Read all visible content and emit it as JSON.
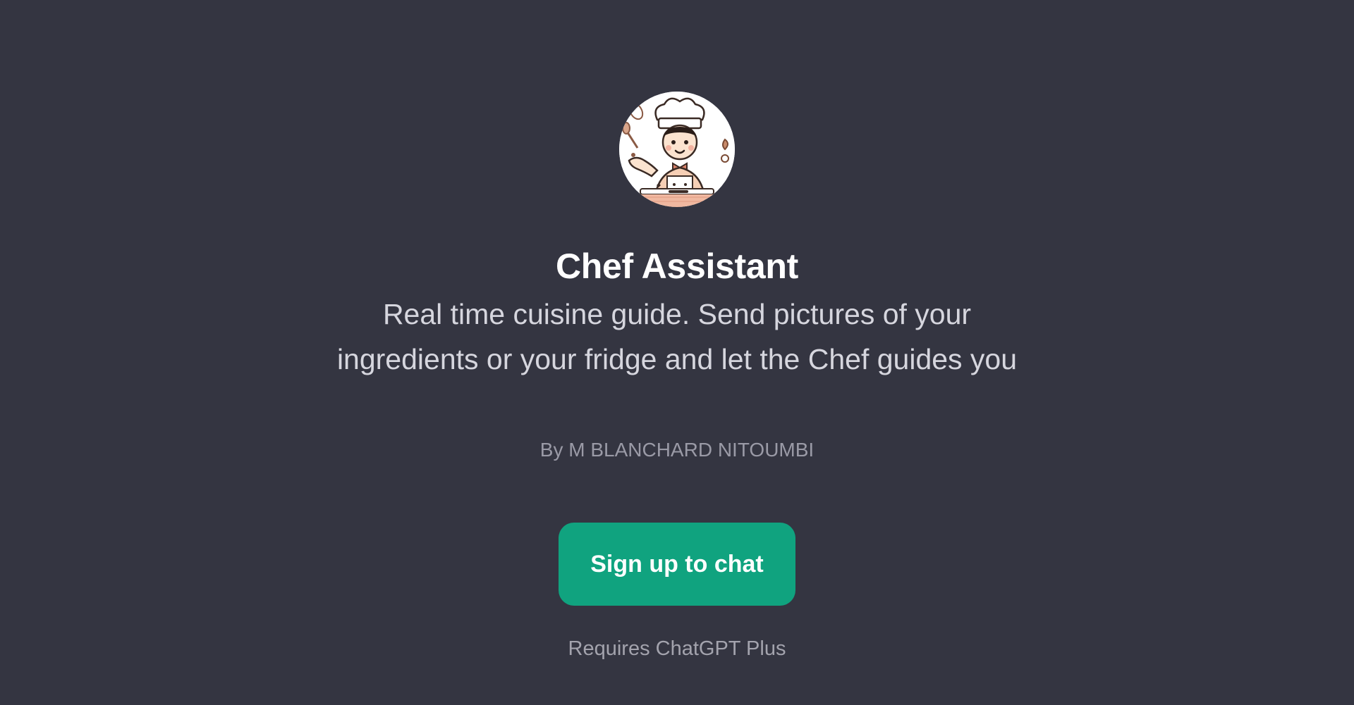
{
  "gpt": {
    "name": "Chef Assistant",
    "description": "Real time cuisine guide. Send pictures of your ingredients or your fridge and let the Chef guides you",
    "author": "By M BLANCHARD NITOUMBI",
    "avatar_icon": "chef-avatar-icon"
  },
  "actions": {
    "signup_label": "Sign up to chat"
  },
  "footer": {
    "requirement": "Requires ChatGPT Plus"
  },
  "colors": {
    "background": "#343541",
    "accent": "#10a37f"
  }
}
